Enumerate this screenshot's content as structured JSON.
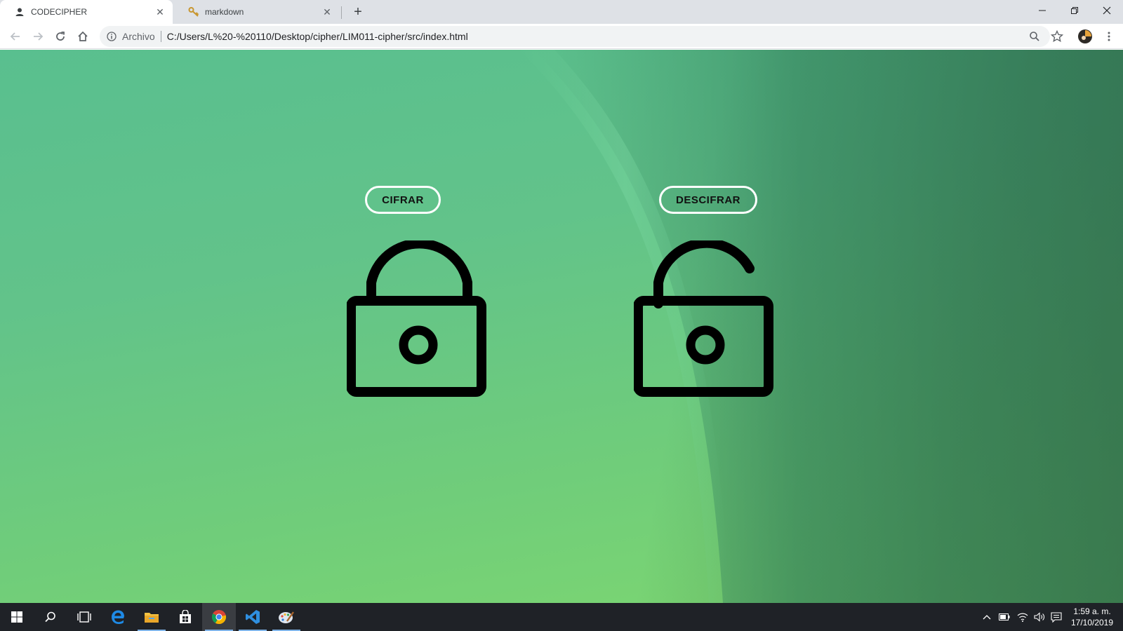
{
  "browser": {
    "tabs": [
      {
        "title": "CODECIPHER",
        "favicon": "person-icon",
        "active": true
      },
      {
        "title": "markdown",
        "favicon": "key-icon",
        "active": false
      }
    ],
    "address": {
      "scheme_label": "Archivo",
      "url": "C:/Users/L%20-%20110/Desktop/cipher/LIM011-cipher/src/index.html"
    }
  },
  "page": {
    "buttons": {
      "encrypt_label": "CIFRAR",
      "decrypt_label": "DESCIFRAR"
    },
    "icons": [
      "lock-closed-icon",
      "lock-open-icon"
    ]
  },
  "taskbar": {
    "apps": [
      "windows-start-icon",
      "search-icon",
      "task-view-icon",
      "edge-icon",
      "file-explorer-icon",
      "store-icon",
      "chrome-icon",
      "vscode-icon",
      "paint-icon"
    ],
    "clock": {
      "time": "1:59 a. m.",
      "date": "17/10/2019"
    }
  },
  "colors": {
    "page_green": "#62c38a",
    "button_border": "#ffffff",
    "taskbar": "#1f2227"
  }
}
